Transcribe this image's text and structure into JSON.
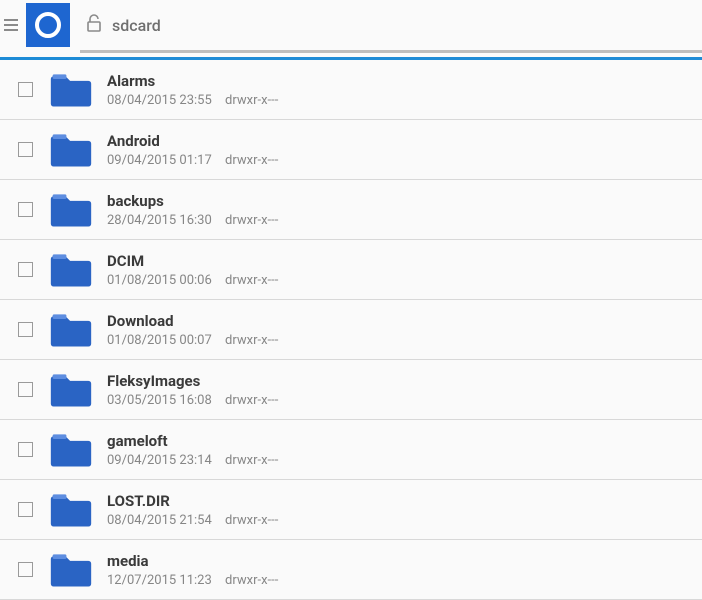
{
  "header": {
    "path": "sdcard"
  },
  "entries": [
    {
      "name": "Alarms",
      "date": "08/04/2015 23:55",
      "perm": "drwxr-x---"
    },
    {
      "name": "Android",
      "date": "09/04/2015 01:17",
      "perm": "drwxr-x---"
    },
    {
      "name": "backups",
      "date": "28/04/2015 16:30",
      "perm": "drwxr-x---"
    },
    {
      "name": "DCIM",
      "date": "01/08/2015 00:06",
      "perm": "drwxr-x---"
    },
    {
      "name": "Download",
      "date": "01/08/2015 00:07",
      "perm": "drwxr-x---"
    },
    {
      "name": "FleksyImages",
      "date": "03/05/2015 16:08",
      "perm": "drwxr-x---"
    },
    {
      "name": "gameloft",
      "date": "09/04/2015 23:14",
      "perm": "drwxr-x---"
    },
    {
      "name": "LOST.DIR",
      "date": "08/04/2015 21:54",
      "perm": "drwxr-x---"
    },
    {
      "name": "media",
      "date": "12/07/2015 11:23",
      "perm": "drwxr-x---"
    }
  ]
}
